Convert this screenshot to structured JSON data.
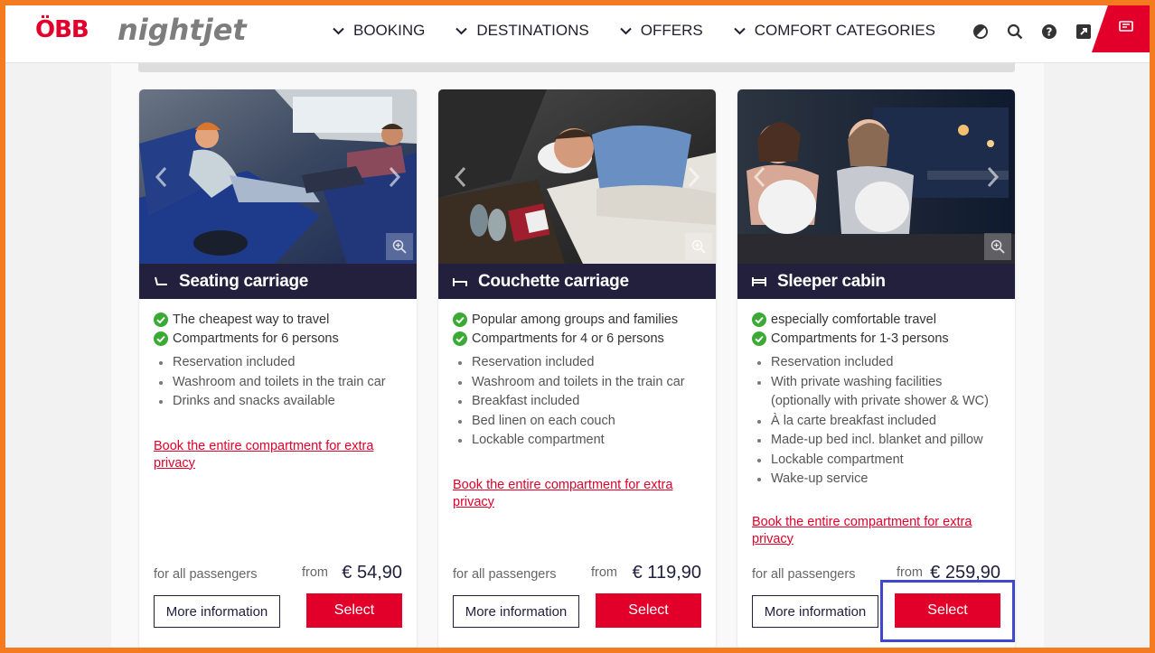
{
  "header": {
    "logo_obb": "ÖBB",
    "logo_nightjet": "nightjet",
    "nav": [
      {
        "label": "BOOKING"
      },
      {
        "label": "DESTINATIONS"
      },
      {
        "label": "OFFERS"
      },
      {
        "label": "COMFORT CATEGORIES"
      }
    ],
    "icons": [
      "contrast-icon",
      "search-icon",
      "help-icon",
      "external-link-icon",
      "ticket-icon"
    ],
    "accent_color": "#e2002a"
  },
  "cards": [
    {
      "title": "Seating carriage",
      "icon": "seat-icon",
      "highlights": [
        "The cheapest way to travel",
        "Compartments for 6 persons"
      ],
      "features": [
        "Reservation included",
        "Washroom and toilets in the train car",
        "Drinks and snacks available"
      ],
      "link": "Book the entire compartment for extra privacy",
      "for_all": "for all passengers",
      "from": "from",
      "price": "€ 54,90",
      "more_label": "More information",
      "select_label": "Select"
    },
    {
      "title": "Couchette carriage",
      "icon": "couchette-icon",
      "highlights": [
        "Popular among groups and families",
        "Compartments for 4 or 6 persons"
      ],
      "features": [
        "Reservation included",
        "Washroom and toilets in the train car",
        "Breakfast included",
        "Bed linen on each couch",
        "Lockable compartment"
      ],
      "link": "Book the entire compartment for extra privacy",
      "for_all": "for all passengers",
      "from": "from",
      "price": "€ 119,90",
      "more_label": "More information",
      "select_label": "Select"
    },
    {
      "title": "Sleeper cabin",
      "icon": "bed-icon",
      "highlights": [
        "especially comfortable travel",
        "Compartments for 1-3 persons"
      ],
      "features": [
        "Reservation included",
        "With private washing facilities (optionally with private shower & WC)",
        "À la carte breakfast included",
        "Made-up bed incl. blanket and pillow",
        "Lockable compartment",
        "Wake-up service"
      ],
      "link": "Book the entire compartment for extra privacy",
      "for_all": "for all passengers",
      "from": "from",
      "price": "€ 259,90",
      "more_label": "More information",
      "select_label": "Select"
    }
  ]
}
